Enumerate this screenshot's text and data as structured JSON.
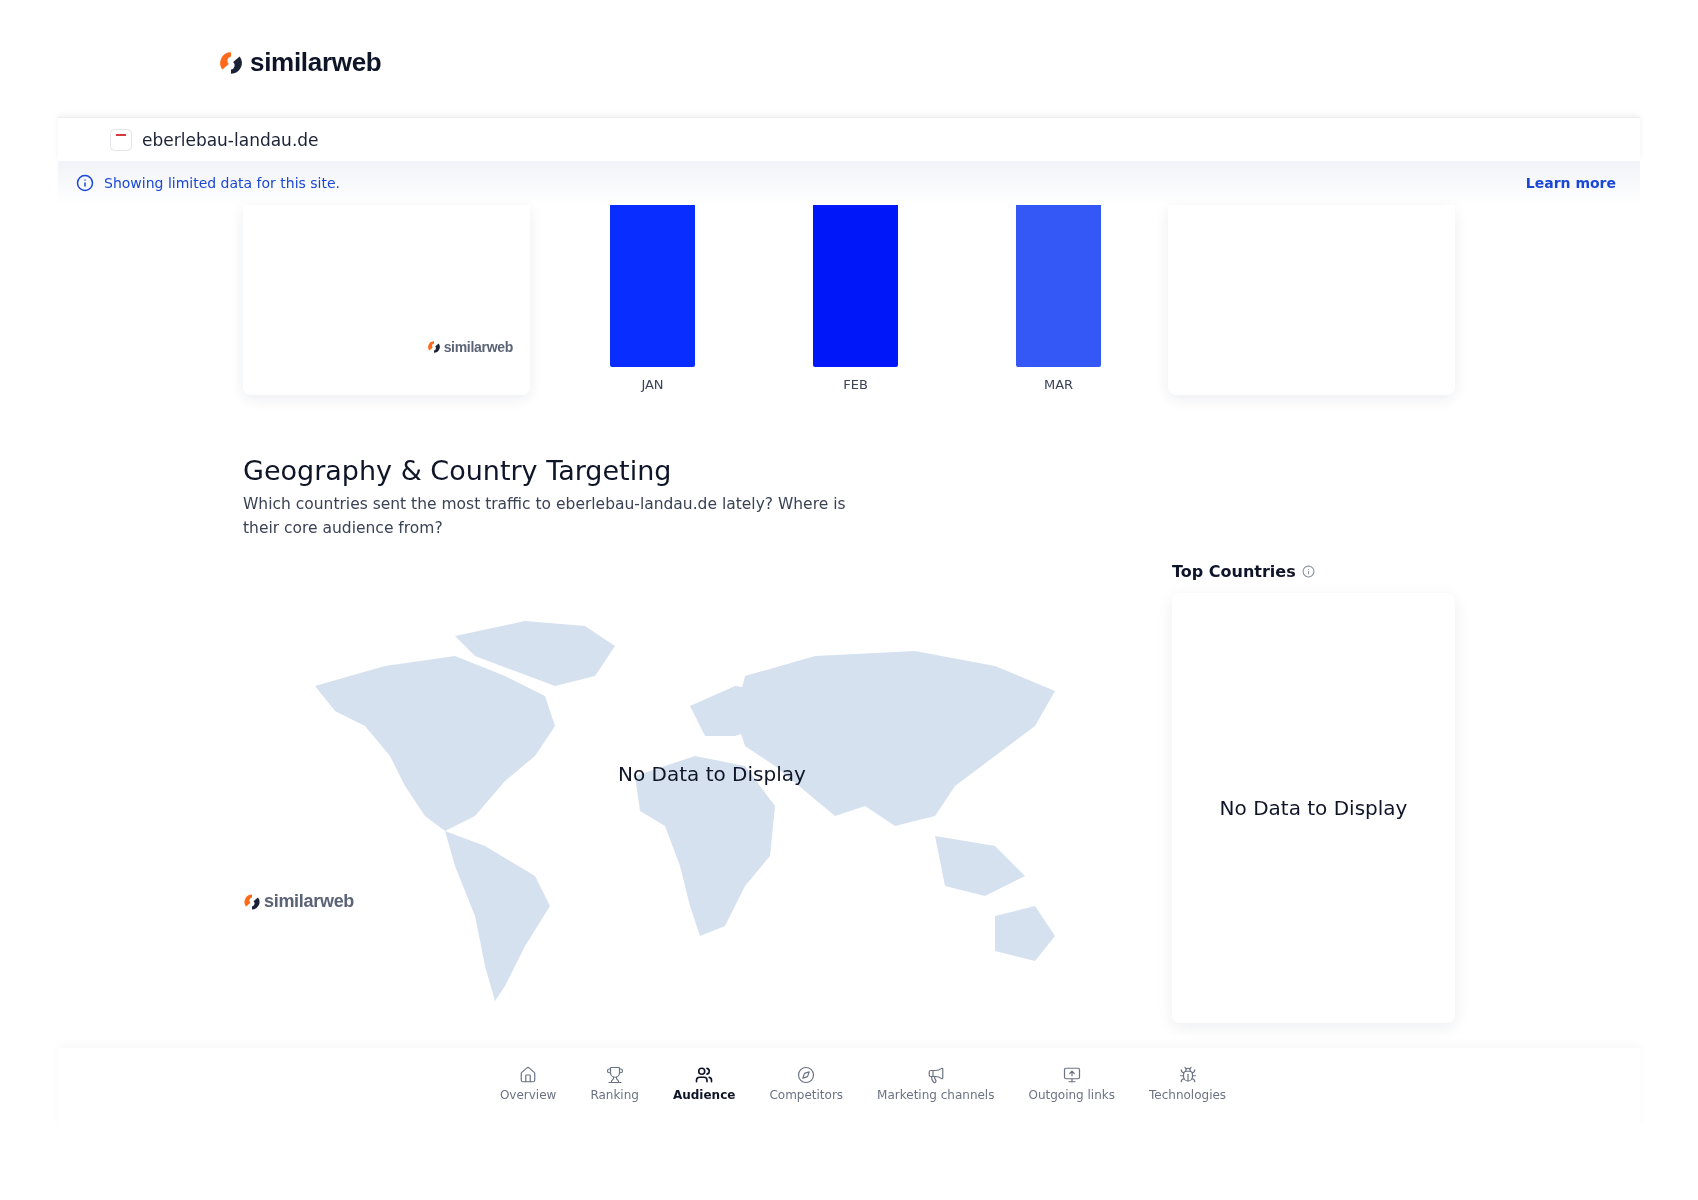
{
  "logo": {
    "text": "similarweb"
  },
  "site": {
    "domain": "eberlebau-landau.de"
  },
  "notice": {
    "text": "Showing limited data for this site.",
    "link": "Learn more"
  },
  "visits_chart": {
    "watermark": "similarweb",
    "months": [
      {
        "label": "JAN",
        "color": "#0a2dff"
      },
      {
        "label": "FEB",
        "color": "#0018f9"
      },
      {
        "label": "MAR",
        "color": "#3358f6"
      }
    ]
  },
  "geography": {
    "title": "Geography & Country Targeting",
    "description": "Which countries sent the most traffic to eberlebau-landau.de lately? Where is their core audience from?",
    "map": {
      "message": "No Data to Display",
      "watermark": "similarweb"
    },
    "top_countries": {
      "title": "Top Countries",
      "message": "No Data to Display"
    }
  },
  "nav": [
    {
      "label": "Overview",
      "kind": "home",
      "selected": false
    },
    {
      "label": "Ranking",
      "kind": "trophy",
      "selected": false
    },
    {
      "label": "Audience",
      "kind": "people",
      "selected": true
    },
    {
      "label": "Competitors",
      "kind": "compass",
      "selected": false
    },
    {
      "label": "Marketing channels",
      "kind": "megaphone",
      "selected": false
    },
    {
      "label": "Outgoing links",
      "kind": "monitor",
      "selected": false
    },
    {
      "label": "Technologies",
      "kind": "bug",
      "selected": false
    }
  ]
}
